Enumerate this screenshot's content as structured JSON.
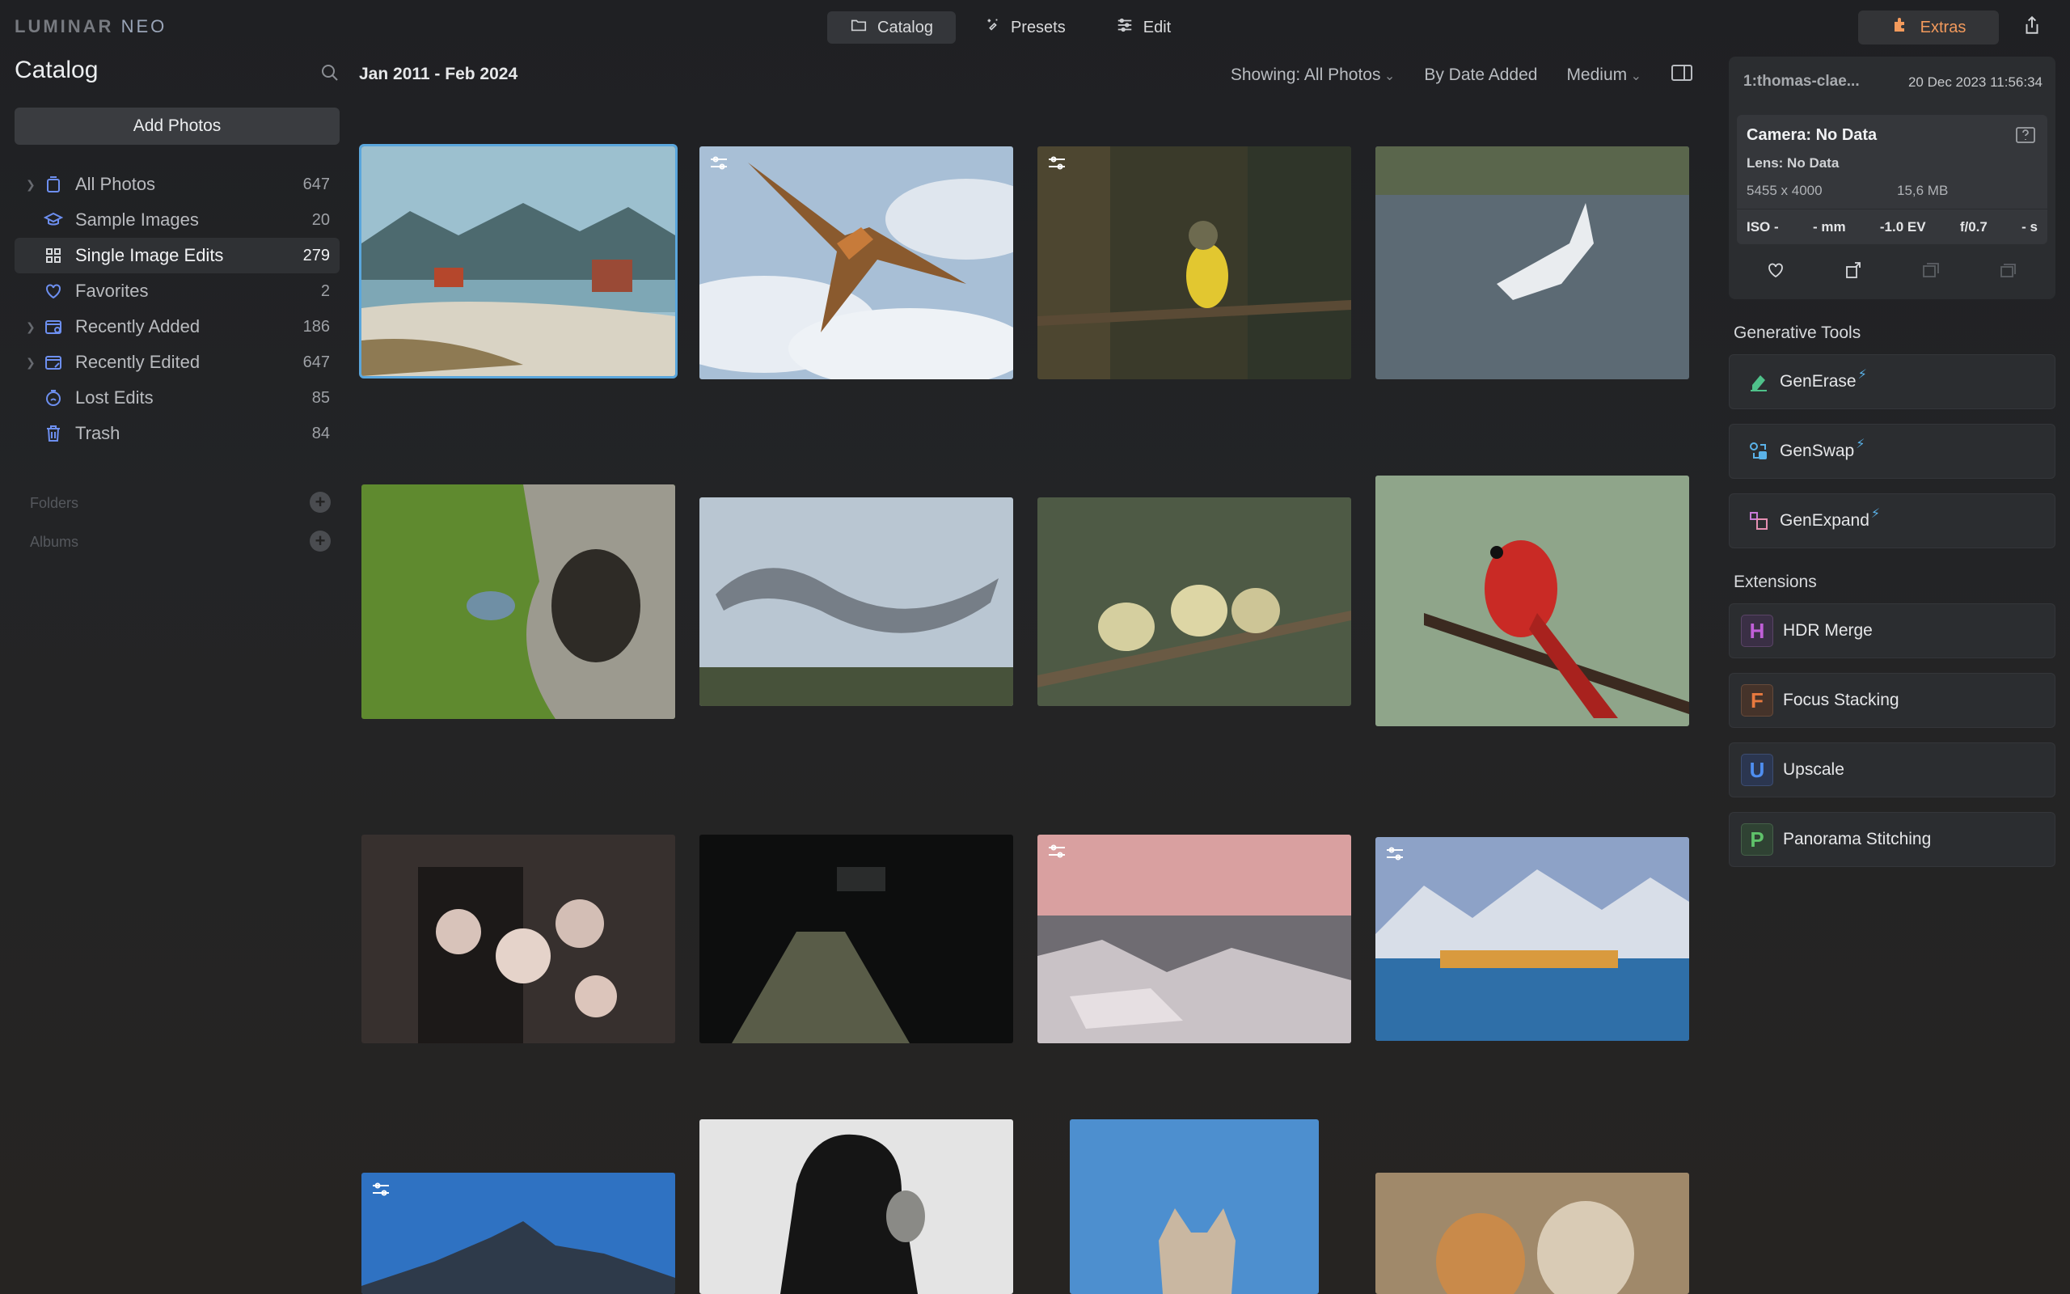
{
  "app": {
    "logo_main": "LUMINAR",
    "logo_sub": "NEO",
    "modes": [
      {
        "label": "Catalog",
        "icon": "folder-icon",
        "active": true
      },
      {
        "label": "Presets",
        "icon": "sparkle-icon",
        "active": false
      },
      {
        "label": "Edit",
        "icon": "sliders-icon",
        "active": false
      }
    ],
    "extras_label": "Extras"
  },
  "sidebar": {
    "title": "Catalog",
    "add_photos_label": "Add Photos",
    "items": [
      {
        "label": "All Photos",
        "count": "647",
        "icon": "all-photos-icon",
        "chevron": true
      },
      {
        "label": "Sample Images",
        "count": "20",
        "icon": "graduation-cap-icon",
        "chevron": false
      },
      {
        "label": "Single Image Edits",
        "count": "279",
        "icon": "grid-icon",
        "chevron": false,
        "selected": true
      },
      {
        "label": "Favorites",
        "count": "2",
        "icon": "heart-icon",
        "chevron": false
      },
      {
        "label": "Recently Added",
        "count": "186",
        "icon": "recently-added-icon",
        "chevron": true
      },
      {
        "label": "Recently Edited",
        "count": "647",
        "icon": "recently-edited-icon",
        "chevron": true
      },
      {
        "label": "Lost Edits",
        "count": "85",
        "icon": "lost-edits-icon",
        "chevron": false
      },
      {
        "label": "Trash",
        "count": "84",
        "icon": "trash-icon",
        "chevron": false
      }
    ],
    "folders_label": "Folders",
    "albums_label": "Albums"
  },
  "main": {
    "date_range": "Jan 2011 - Feb 2024",
    "showing": "Showing: All Photos",
    "sort": "By Date Added",
    "size": "Medium"
  },
  "info": {
    "filename": "1:thomas-clae...",
    "date": "20 Dec 2023 11:56:34",
    "camera": "Camera: No Data",
    "lens": "Lens: No Data",
    "dimensions": "5455 x 4000",
    "filesize": "15,6 MB",
    "iso": "ISO -",
    "focal": "- mm",
    "ev": "-1.0 EV",
    "aperture": "f/0.7",
    "shutter": "- s"
  },
  "generative": {
    "title": "Generative Tools",
    "tools": [
      {
        "label": "GenErase",
        "icon": "eraser-icon"
      },
      {
        "label": "GenSwap",
        "icon": "swap-icon"
      },
      {
        "label": "GenExpand",
        "icon": "expand-icon"
      }
    ]
  },
  "extensions": {
    "title": "Extensions",
    "items": [
      {
        "letter": "H",
        "label": "HDR Merge",
        "color": "#c05fd8"
      },
      {
        "letter": "F",
        "label": "Focus Stacking",
        "color": "#e8793f"
      },
      {
        "letter": "U",
        "label": "Upscale",
        "color": "#4f8ef0"
      },
      {
        "letter": "P",
        "label": "Panorama Stitching",
        "color": "#5fc26a"
      }
    ]
  },
  "colors": {
    "accent_selection": "#5aa6dc",
    "extras_orange": "#f39a5c",
    "catalog_icon_blue": "#6d8ff0"
  }
}
